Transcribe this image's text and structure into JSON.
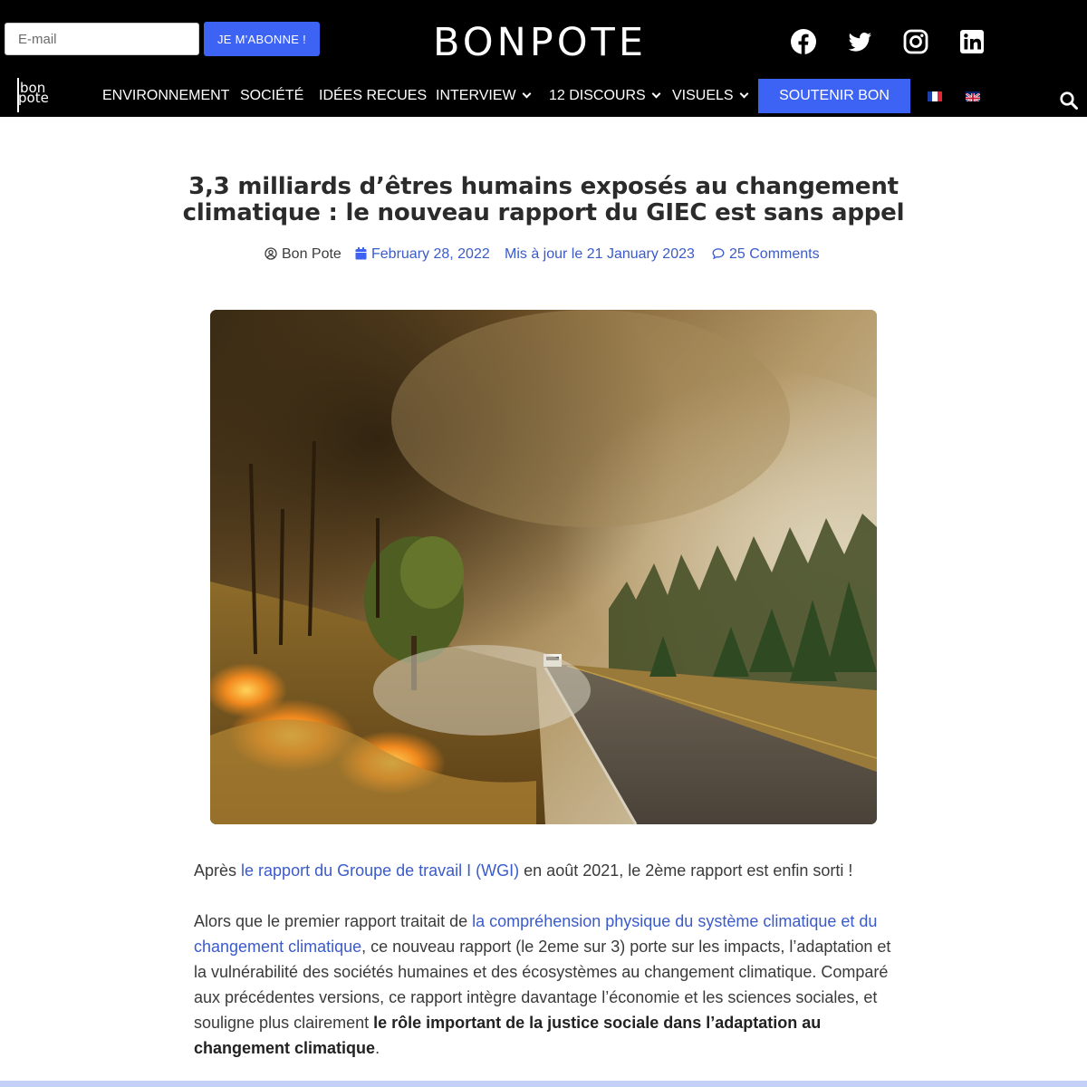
{
  "header": {
    "email_placeholder": "E-mail",
    "subscribe_label": "JE M'ABONNE !",
    "brand": "BONPOTE",
    "social": [
      "facebook-icon",
      "twitter-icon",
      "instagram-icon",
      "linkedin-icon"
    ]
  },
  "nav": {
    "logo_line1": "bon",
    "logo_line2": "pote",
    "items": [
      {
        "label": "ENVIRONNEMENT"
      },
      {
        "label": "SOCIÉTÉ"
      },
      {
        "label": "IDÉES RECUES"
      },
      {
        "label": "INTERVIEW"
      },
      {
        "label": "12 DISCOURS"
      },
      {
        "label": "VISUELS"
      }
    ],
    "support_label": "SOUTENIR BON POTE",
    "languages": [
      "fr",
      "en"
    ]
  },
  "article": {
    "title_line1": "3,3 milliards d’êtres humains exposés au changement",
    "title_line2": "climatique : le nouveau rapport du GIEC est sans appel",
    "author": "Bon Pote",
    "date": "February 28, 2022",
    "updated": "Mis à jour le 21 January 2023",
    "comments": "25 Comments",
    "p1": {
      "before": "Après ",
      "link": "le rapport du Groupe de travail I (WGI)",
      "after": " en août 2021, le 2ème rapport est enfin sorti !"
    },
    "p2": {
      "before": "Alors que le premier rapport traitait de ",
      "link": "la compréhension physique du système climatique et du changement climatique",
      "middle": ", ce nouveau rapport (le 2eme sur 3) porte sur les impacts, l’adaptation et la vulnérabilité des sociétés humaines et des écosystèmes au changement climatique. Comparé aux précédentes versions, ce rapport intègre davantage l’économie et les sciences sociales, et souligne plus clairement ",
      "bold": "le rôle important de la justice sociale dans l’adaptation au changement climatique",
      "after": "."
    }
  },
  "colors": {
    "accent": "#3d63f5",
    "link": "#3a5bc9",
    "header_bg": "#000000"
  }
}
